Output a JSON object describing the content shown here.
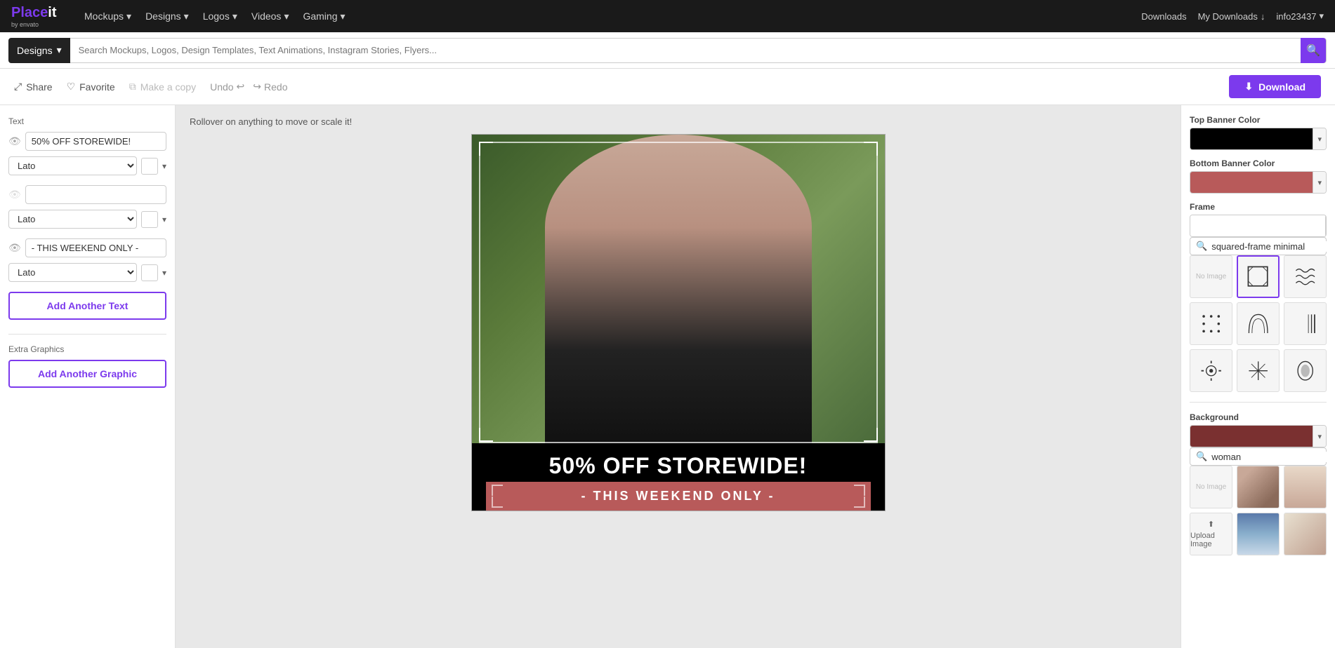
{
  "app": {
    "logo_place": "Place",
    "logo_it": "it",
    "logo_sub": "by envato"
  },
  "nav": {
    "items": [
      {
        "label": "Mockups",
        "id": "mockups"
      },
      {
        "label": "Designs",
        "id": "designs"
      },
      {
        "label": "Logos",
        "id": "logos"
      },
      {
        "label": "Videos",
        "id": "videos"
      },
      {
        "label": "Gaming",
        "id": "gaming"
      }
    ],
    "my_downloads": "My Downloads",
    "username": "info23437",
    "downloads_tab": "Downloads"
  },
  "search": {
    "select_label": "Designs",
    "placeholder": "Search Mockups, Logos, Design Templates, Text Animations, Instagram Stories, Flyers..."
  },
  "toolbar": {
    "share_label": "Share",
    "favorite_label": "Favorite",
    "make_copy_label": "Make a copy",
    "undo_label": "Undo",
    "redo_label": "Redo",
    "download_label": "Download"
  },
  "left_panel": {
    "text_section_label": "Text",
    "fields": [
      {
        "value": "50% OFF STOREWIDE!",
        "id": "text1"
      },
      {
        "value": "",
        "id": "text2"
      },
      {
        "value": "- THIS WEEKEND ONLY -",
        "id": "text3"
      }
    ],
    "font_lato": "Lato",
    "add_text_label": "Add Another Text",
    "extra_graphics_label": "Extra Graphics",
    "add_graphic_label": "Add Another Graphic"
  },
  "right_panel": {
    "top_banner_color_label": "Top Banner Color",
    "top_banner_color": "#000000",
    "bottom_banner_color_label": "Bottom Banner Color",
    "bottom_banner_color": "#b85a5a",
    "frame_label": "Frame",
    "frame_search_value": "squared-frame minimal",
    "background_label": "Background",
    "background_color": "#7a3030",
    "bg_search_value": "woman"
  },
  "canvas": {
    "hint": "Rollover on anything to move or scale it!",
    "main_text": "50% OFF STOREWIDE!",
    "sub_text": "- THIS WEEKEND ONLY -"
  }
}
